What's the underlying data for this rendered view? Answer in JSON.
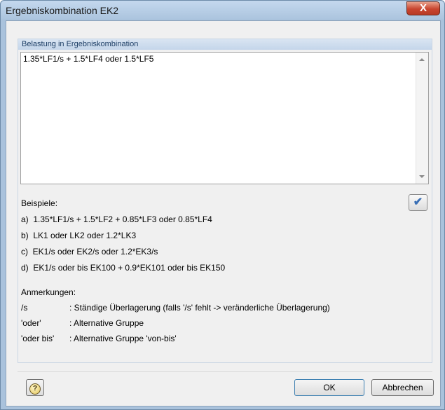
{
  "window": {
    "title": "Ergebniskombination EK2",
    "close_symbol": "X"
  },
  "group": {
    "title": "Belastung in Ergebniskombination"
  },
  "editor": {
    "value": "1.35*LF1/s + 1.5*LF4 oder 1.5*LF5"
  },
  "examples": {
    "heading": "Beispiele:",
    "items": [
      "a)  1.35*LF1/s + 1.5*LF2 + 0.85*LF3 oder 0.85*LF4",
      "b)  LK1 oder LK2 oder 1.2*LK3",
      "c)  EK1/s oder EK2/s oder 1.2*EK3/s",
      "d)  EK1/s oder bis EK100 + 0.9*EK101 oder bis EK150"
    ]
  },
  "notes": {
    "heading": "Anmerkungen:",
    "items": [
      {
        "key": "/s",
        "desc": ": Ständige Überlagerung (falls '/s' fehlt -> veränderliche Überlagerung)"
      },
      {
        "key": "'oder'",
        "desc": ": Alternative Gruppe"
      },
      {
        "key": "'oder bis'",
        "desc": ": Alternative Gruppe 'von-bis'"
      }
    ]
  },
  "buttons": {
    "help_symbol": "?",
    "ok": "OK",
    "cancel": "Abbrechen"
  },
  "icons": {
    "check": "check-icon",
    "help": "help-icon",
    "close": "close-icon"
  }
}
